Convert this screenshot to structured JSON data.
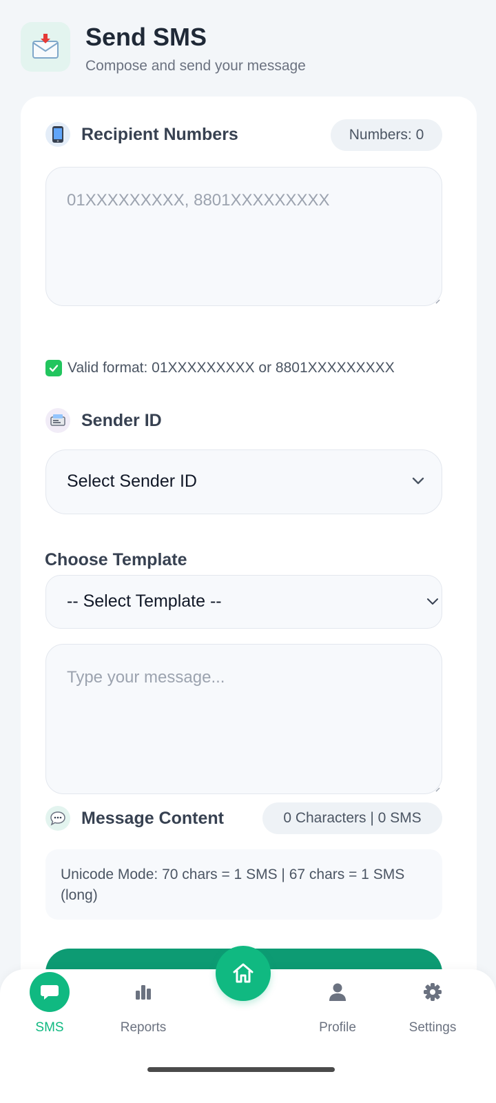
{
  "header": {
    "title": "Send SMS",
    "subtitle": "Compose and send your message",
    "icon": "inbox-tray-icon"
  },
  "recipients": {
    "label": "Recipient Numbers",
    "count_label": "Numbers: 0",
    "placeholder": "01XXXXXXXXX, 8801XXXXXXXXX",
    "value": "",
    "hint": "Valid format: 01XXXXXXXXX or 8801XXXXXXXXX"
  },
  "sender": {
    "label": "Sender ID",
    "selected": "Select Sender ID"
  },
  "template": {
    "label": "Choose Template",
    "selected": "-- Select Template --"
  },
  "message": {
    "placeholder": "Type your message...",
    "value": "",
    "label": "Message Content",
    "counter": "0 Characters | 0 SMS",
    "info": "Unicode Mode: 70 chars = 1 SMS | 67 chars = 1 SMS (long)"
  },
  "nav": {
    "tabs": [
      {
        "label": "SMS",
        "icon": "chat-bubble-icon",
        "active": true
      },
      {
        "label": "Reports",
        "icon": "bar-chart-icon",
        "active": false
      },
      {
        "label": "Profile",
        "icon": "user-icon",
        "active": false
      },
      {
        "label": "Settings",
        "icon": "gear-icon",
        "active": false
      }
    ],
    "center": {
      "icon": "home-icon"
    }
  },
  "colors": {
    "accent": "#10b981",
    "button": "#0d9b73",
    "background": "#f3f6f9"
  }
}
